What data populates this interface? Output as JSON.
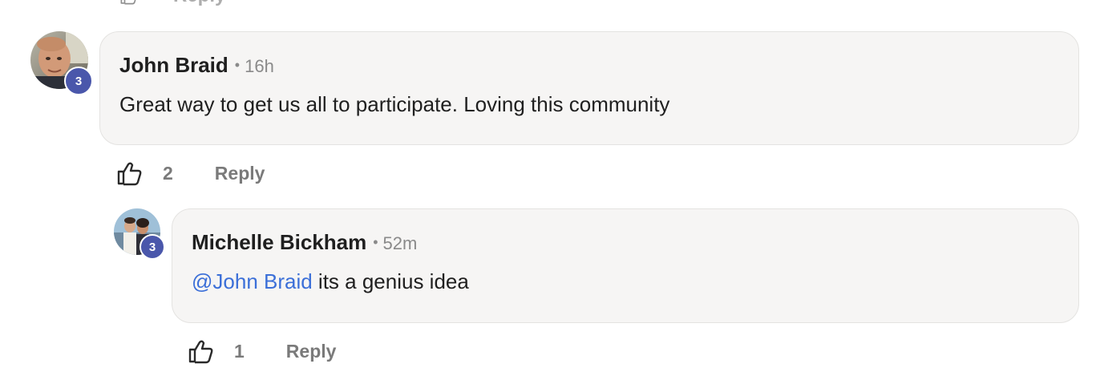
{
  "previous_actions": {
    "reply_label": "Reply"
  },
  "comment": {
    "author": "John Braid",
    "separator": "•",
    "time": "16h",
    "text": "Great way to get us all to participate. Loving this community",
    "badge": "3",
    "like_count": "2",
    "reply_label": "Reply"
  },
  "reply": {
    "author": "Michelle Bickham",
    "separator": "•",
    "time": "52m",
    "mention": "@John Braid",
    "text": " its a genius idea",
    "badge": "3",
    "like_count": "1",
    "reply_label": "Reply"
  },
  "colors": {
    "badge": "#4a57ab",
    "mention": "#3b6fd8",
    "bubble": "#f6f5f4",
    "muted": "#7a7a7a"
  },
  "icons": {
    "like": "thumbs-up-icon"
  }
}
